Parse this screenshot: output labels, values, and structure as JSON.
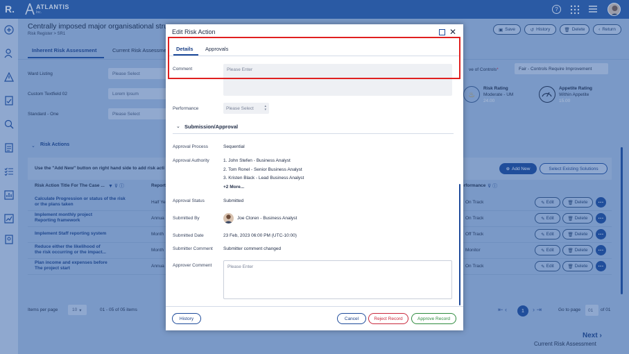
{
  "app": {
    "logo_letter": "R.",
    "brand": "ATLANTIS",
    "brand_sub": "Inc."
  },
  "page": {
    "title": "Centrally imposed major organisational struc",
    "breadcrumb": "Risk Register > SR1",
    "save": "Save",
    "history": "History",
    "delete": "Delete",
    "return": "Return"
  },
  "tabs": {
    "inherent": "Inherent Risk Assessment",
    "current": "Current Risk Assessmen"
  },
  "form": {
    "ward_label": "Ward Listing",
    "ward_value": "Please Select",
    "custom_label": "Custom Textfield 02",
    "custom_value": "Lorem Ipsum",
    "standard_label": "Standard - One",
    "standard_value": "Please Select",
    "controls_label": "ve of Controls",
    "controls_required": "*",
    "controls_value": "Fair - Controls Require Improvement",
    "risk_rating_title": "Risk Rating",
    "risk_rating_value": "Moderate - UM",
    "risk_rating_num": "24.00",
    "appetite_title": "Appetite Rating",
    "appetite_value": "Within Appetite",
    "appetite_num": "15.00"
  },
  "risk_actions": {
    "section_title": "Risk Actions",
    "hint": "Use the \"Add New\" button on right hand side to add risk acti",
    "add_new": "Add New",
    "existing": "Select Existing Solutions",
    "col_title": "Risk Action Title For The Case ...",
    "col_report": "Report",
    "col_performance": "erformance",
    "rows": [
      {
        "title1": "Calculate Progression or status of the risk",
        "title2": "or the plans taken",
        "freq": "Half Ye",
        "perf": "On Track"
      },
      {
        "title1": "Implement monthly project",
        "title2": "Reporting framework",
        "freq": "Annua",
        "perf": "On Track"
      },
      {
        "title1": "Implement Staff reporting system",
        "title2": "",
        "freq": "Month",
        "perf": "Off Track"
      },
      {
        "title1": "Reduce either the likelihood of",
        "title2": "the risk occurring or the impact...",
        "freq": "Month",
        "perf": "Monitor"
      },
      {
        "title1": "Plan income and expenses before",
        "title2": "The project start",
        "freq": "Annua",
        "perf": "On Track"
      }
    ],
    "edit": "Edit",
    "delete": "Delete"
  },
  "pagination": {
    "items_per_page": "Items per page",
    "per_page": "10",
    "range": "01 - 05 of 05 items",
    "current": "1",
    "goto": "Go to page",
    "goto_value": "01",
    "of": "of 01"
  },
  "footer": {
    "next": "Next",
    "next_sub": "Current Risk Assessment"
  },
  "modal": {
    "title": "Edit Risk Action",
    "tab_details": "Details",
    "tab_approvals": "Approvals",
    "comment_label": "Comment",
    "comment_placeholder": "Please Enter",
    "performance_label": "Performance",
    "performance_value": "Please Select",
    "section": "Submission/Approval",
    "approval_process_label": "Approval Process",
    "approval_process_value": "Sequential",
    "approval_authority_label": "Approval Authority",
    "authorities": [
      "1. John Stefen - Business Analyst",
      "2. Tom Ronel - Senior Business Analyst",
      "3. Kristen Black - Lead Business Analyst"
    ],
    "more": "+2 More...",
    "approval_status_label": "Approval Status",
    "approval_status_value": "Submitted",
    "submitted_by_label": "Submitted By",
    "submitted_by_value": "Joe Cloren - Business Analyst",
    "submitted_date_label": "Submitted Date",
    "submitted_date_value": "23 Feb, 2023 06:00 PM (UTC-10:00)",
    "submitter_comment_label": "Submitter Comment",
    "submitter_comment_value": "Submitter comment changed",
    "approver_comment_label": "Approver Comment",
    "approver_comment_placeholder": "Please Enter",
    "history": "History",
    "cancel": "Cancel",
    "reject": "Reject Record",
    "approve": "Approve Record"
  },
  "colors": {
    "accent": "#1d4a9a",
    "highlight": "#e02020",
    "reject": "#c8283c",
    "approve": "#2e8b3e"
  }
}
